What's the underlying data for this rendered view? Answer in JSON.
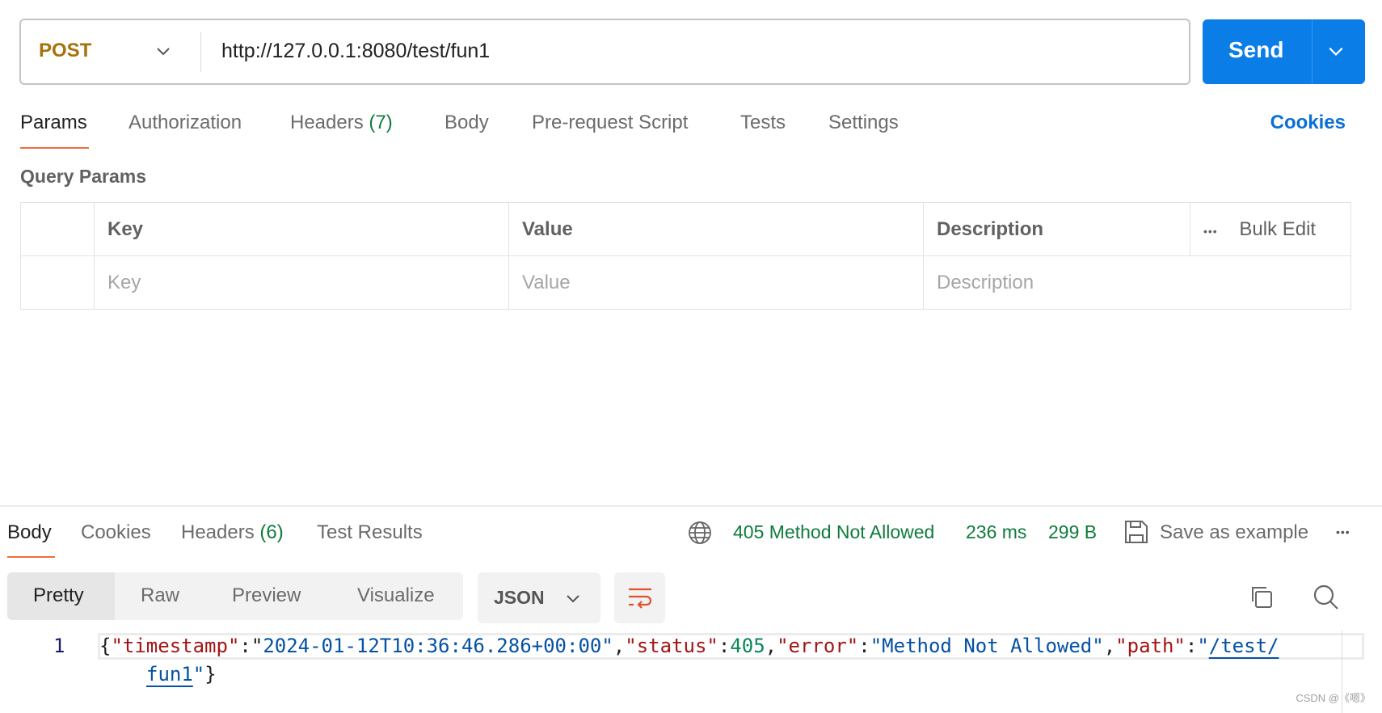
{
  "request": {
    "method": "POST",
    "url": "http://127.0.0.1:8080/test/fun1",
    "send_label": "Send"
  },
  "tabs": [
    {
      "label": "Params"
    },
    {
      "label": "Authorization"
    },
    {
      "label": "Headers",
      "count": "(7)"
    },
    {
      "label": "Body"
    },
    {
      "label": "Pre-request Script"
    },
    {
      "label": "Tests"
    },
    {
      "label": "Settings"
    }
  ],
  "cookies_link": "Cookies",
  "query_params": {
    "title": "Query Params",
    "columns": [
      "Key",
      "Value",
      "Description"
    ],
    "more": "•••",
    "bulk_edit": "Bulk Edit",
    "placeholders": [
      "Key",
      "Value",
      "Description"
    ]
  },
  "response": {
    "tabs": [
      {
        "label": "Body"
      },
      {
        "label": "Cookies"
      },
      {
        "label": "Headers",
        "count": "(6)"
      },
      {
        "label": "Test Results"
      }
    ],
    "status": "405 Method Not Allowed",
    "time": "236 ms",
    "size": "299 B",
    "save_example": "Save as example",
    "more": "•••",
    "view_modes": [
      "Pretty",
      "Raw",
      "Preview",
      "Visualize"
    ],
    "format": "JSON",
    "line_number": "1",
    "body": {
      "timestamp": "2024-01-12T10:36:46.286+00:00",
      "status": "405",
      "error": "Method Not Allowed",
      "path_part1": "/test/",
      "path_part2": "fun1"
    },
    "keys": {
      "timestamp": "\"timestamp\"",
      "status": "\"status\"",
      "error": "\"error\"",
      "path": "\"path\""
    }
  },
  "watermark": "CSDN @《嗯》",
  "colors": {
    "accent": "#0b7de6",
    "method": "#a7710b",
    "success": "#0f7b3b",
    "tab_underline": "#f26b3a"
  }
}
